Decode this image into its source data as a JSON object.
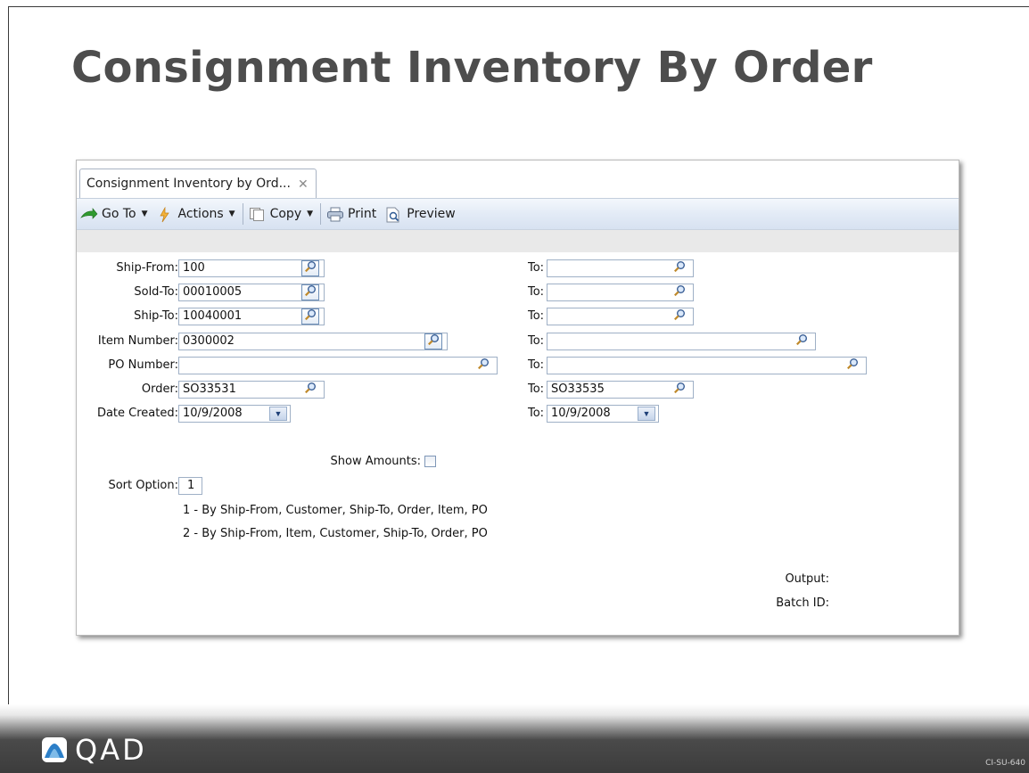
{
  "slide": {
    "title": "Consignment Inventory By Order",
    "footer_logo": "QAD",
    "footer_code": "CI-SU-640"
  },
  "app": {
    "tab_label": "Consignment Inventory by Ord...",
    "toolbar": {
      "goto": "Go To",
      "actions": "Actions",
      "copy": "Copy",
      "print": "Print",
      "preview": "Preview"
    },
    "form": {
      "ship_from_label": "Ship-From:",
      "ship_from_value": "100",
      "sold_to_label": "Sold-To:",
      "sold_to_value": "00010005",
      "ship_to_label": "Ship-To:",
      "ship_to_value": "10040001",
      "item_number_label": "Item Number:",
      "item_number_value": "0300002",
      "po_number_label": "PO Number:",
      "po_number_value": "",
      "order_label": "Order:",
      "order_value": "SO33531",
      "date_created_label": "Date Created:",
      "date_created_value": "10/9/2008",
      "to_label": "To:",
      "to_ship_from": "",
      "to_sold_to": "",
      "to_ship_to": "",
      "to_item_number": "",
      "to_po_number": "",
      "to_order": "SO33535",
      "to_date_created": "10/9/2008",
      "show_amounts_label": "Show Amounts:",
      "show_amounts_checked": false,
      "sort_option_label": "Sort Option:",
      "sort_option_value": "1",
      "sort_option_1": "1 - By Ship-From, Customer, Ship-To, Order, Item, PO",
      "sort_option_2": "2 - By Ship-From, Item, Customer, Ship-To, Order, PO",
      "output_label": "Output:",
      "batch_id_label": "Batch ID:"
    }
  }
}
